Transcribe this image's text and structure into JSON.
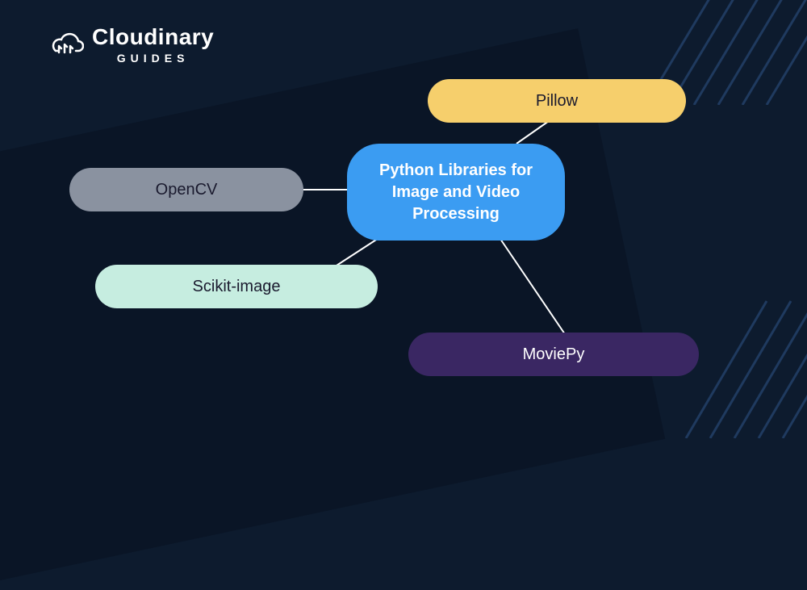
{
  "logo": {
    "brand": "Cloudinary",
    "sub": "GUIDES"
  },
  "center": {
    "label": "Python Libraries for Image and Video Processing",
    "color": "#3b9cf2"
  },
  "nodes": {
    "pillow": {
      "label": "Pillow",
      "color": "#f6cf6c"
    },
    "opencv": {
      "label": "OpenCV",
      "color": "#8a92a0"
    },
    "scikit": {
      "label": "Scikit-image",
      "color": "#c6ede0"
    },
    "moviepy": {
      "label": "MoviePy",
      "color": "#3a2763"
    }
  }
}
